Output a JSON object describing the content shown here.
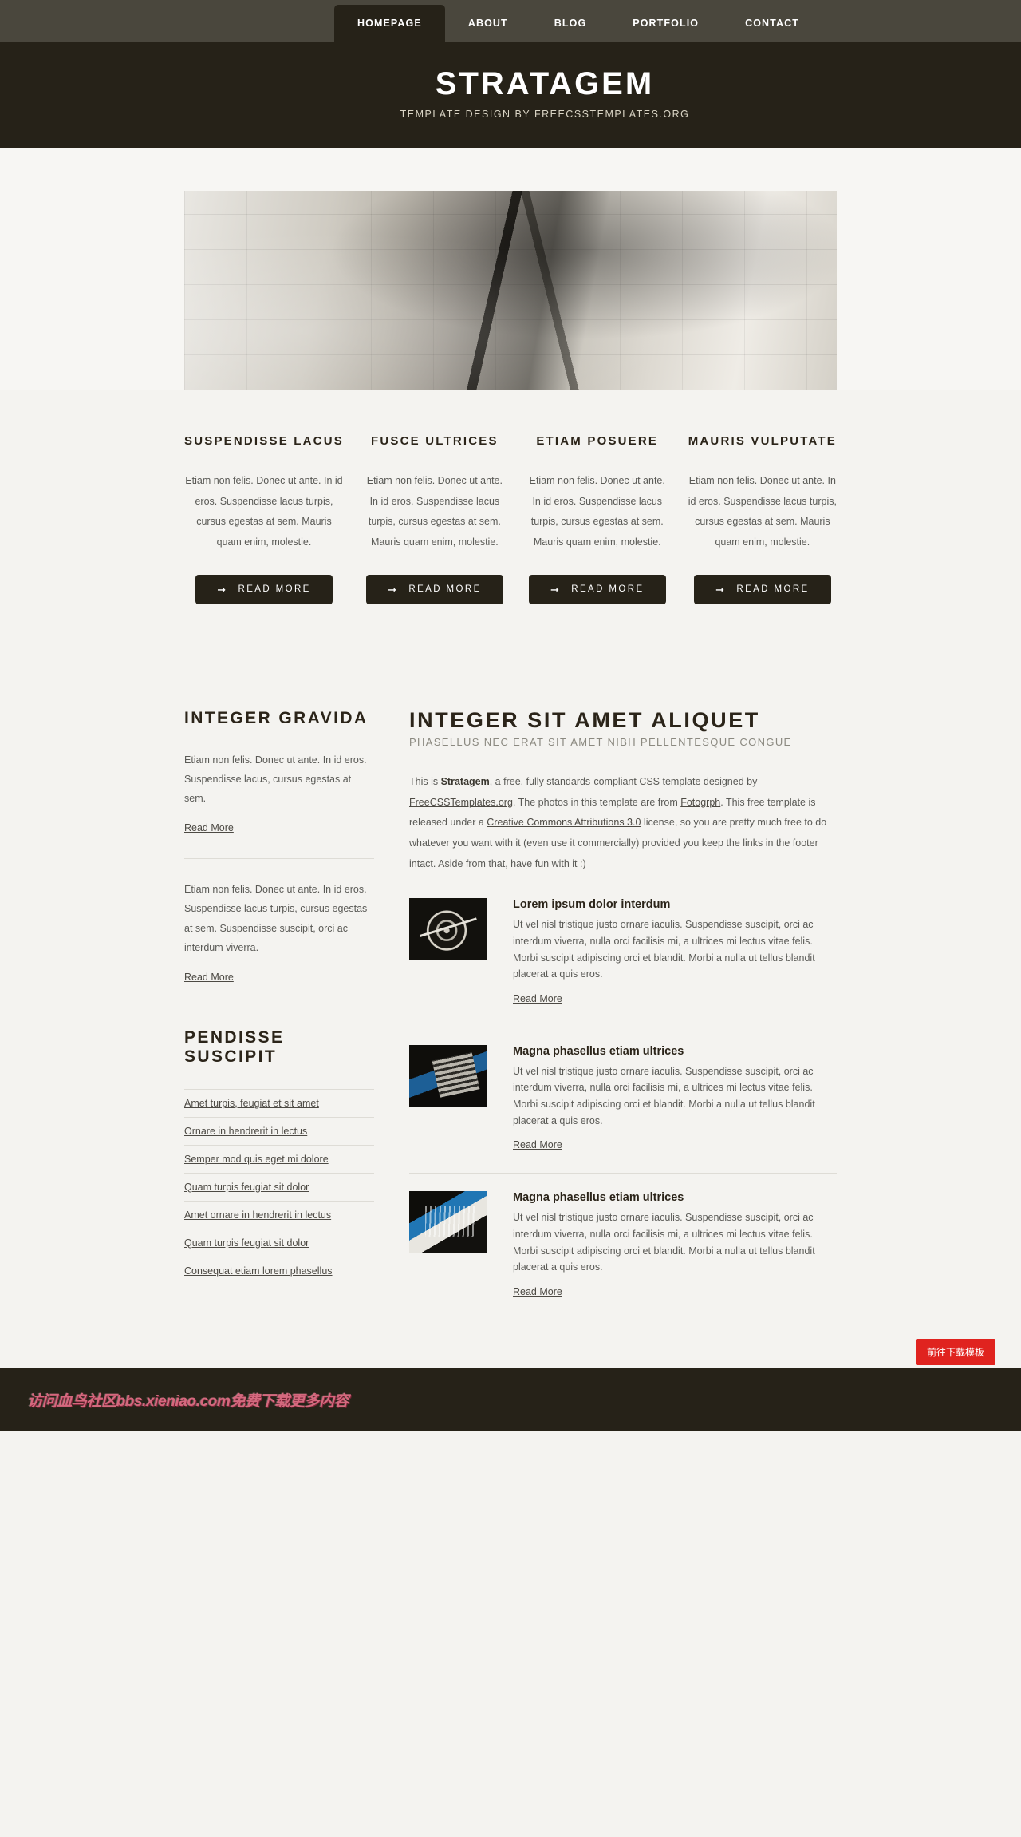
{
  "nav": {
    "items": [
      {
        "label": "HOMEPAGE",
        "active": true
      },
      {
        "label": "ABOUT",
        "active": false
      },
      {
        "label": "BLOG",
        "active": false
      },
      {
        "label": "PORTFOLIO",
        "active": false
      },
      {
        "label": "CONTACT",
        "active": false
      }
    ]
  },
  "header": {
    "title": "STRATAGEM",
    "tagline": "TEMPLATE DESIGN BY FREECSSTEMPLATES.ORG"
  },
  "features": [
    {
      "title": "SUSPENDISSE LACUS",
      "text": "Etiam non felis. Donec ut ante. In id eros. Suspendisse lacus turpis, cursus egestas at sem. Mauris quam enim, molestie.",
      "button": "READ MORE",
      "arrow": "arrow-right-icon"
    },
    {
      "title": "FUSCE ULTRICES",
      "text": "Etiam non felis. Donec ut ante. In id eros. Suspendisse lacus turpis, cursus egestas at sem. Mauris quam enim, molestie.",
      "button": "READ MORE",
      "arrow": "arrow-right-icon"
    },
    {
      "title": "ETIAM POSUERE",
      "text": "Etiam non felis. Donec ut ante. In id eros. Suspendisse lacus turpis, cursus egestas at sem. Mauris quam enim, molestie.",
      "button": "READ MORE",
      "arrow": "arrow-right-icon"
    },
    {
      "title": "MAURIS VULPUTATE",
      "text": "Etiam non felis. Donec ut ante. In id eros. Suspendisse lacus turpis, cursus egestas at sem. Mauris quam enim, molestie.",
      "button": "READ MORE",
      "arrow": "arrow-right-icon"
    }
  ],
  "sidebar": {
    "heading": "INTEGER GRAVIDA",
    "blocks": [
      {
        "text": "Etiam non felis. Donec ut ante. In id eros. Suspendisse lacus, cursus egestas at sem.",
        "link": "Read More"
      },
      {
        "text": "Etiam non felis. Donec ut ante. In id eros. Suspendisse lacus turpis, cursus egestas at sem. Suspendisse suscipit, orci ac interdum viverra.",
        "link": "Read More"
      }
    ],
    "heading2": "PENDISSE SUSCIPIT",
    "links": [
      "Amet turpis, feugiat et sit amet",
      "Ornare in hendrerit in lectus",
      "Semper mod quis eget mi dolore",
      "Quam turpis feugiat sit dolor",
      "Amet ornare in hendrerit in lectus",
      "Quam turpis feugiat sit dolor",
      "Consequat etiam lorem phasellus"
    ]
  },
  "content": {
    "heading": "INTEGER SIT AMET ALIQUET",
    "subheading": "PHASELLUS NEC ERAT SIT AMET NIBH PELLENTESQUE CONGUE",
    "intro": {
      "part1": "This is ",
      "brand": "Stratagem",
      "part2": ", a free, fully standards-compliant CSS template designed by ",
      "link1": "FreeCSSTemplates.org",
      "part3": ". The photos in this template are from ",
      "link2": "Fotogrph",
      "part4": ". This free template is released under a ",
      "link3": "Creative Commons Attributions 3.0",
      "part5": " license, so you are pretty much free to do whatever you want with it (even use it commercially) provided you keep the links in the footer intact. Aside from that, have fun with it :)"
    },
    "posts": [
      {
        "title": "Lorem ipsum dolor interdum",
        "text": "Ut vel nisl tristique justo ornare iaculis. Suspendisse suscipit, orci ac interdum viverra, nulla orci facilisis mi, a ultrices mi lectus vitae felis. Morbi suscipit adipiscing orci et blandit. Morbi a nulla ut tellus blandit placerat a quis eros.",
        "more": "Read More",
        "thumb": "compass-photo"
      },
      {
        "title": "Magna phasellus etiam ultrices",
        "text": "Ut vel nisl tristique justo ornare iaculis. Suspendisse suscipit, orci ac interdum viverra, nulla orci facilisis mi, a ultrices mi lectus vitae felis. Morbi suscipit adipiscing orci et blandit. Morbi a nulla ut tellus blandit placerat a quis eros.",
        "more": "Read More",
        "thumb": "calculator-photo"
      },
      {
        "title": "Magna phasellus etiam ultrices",
        "text": "Ut vel nisl tristique justo ornare iaculis. Suspendisse suscipit, orci ac interdum viverra, nulla orci facilisis mi, a ultrices mi lectus vitae felis. Morbi suscipit adipiscing orci et blandit. Morbi a nulla ut tellus blandit placerat a quis eros.",
        "more": "Read More",
        "thumb": "turntable-photo"
      }
    ]
  },
  "footer": {
    "watermark": "访问血鸟社区bbs.xieniao.com免费下载更多内容",
    "download_button": "前往下载模板"
  },
  "colors": {
    "nav_bar": "#4a473d",
    "dark": "#262218",
    "page_bg": "#f4f3f0",
    "accent_red": "#e0231f",
    "watermark_pink": "#d4697e"
  }
}
